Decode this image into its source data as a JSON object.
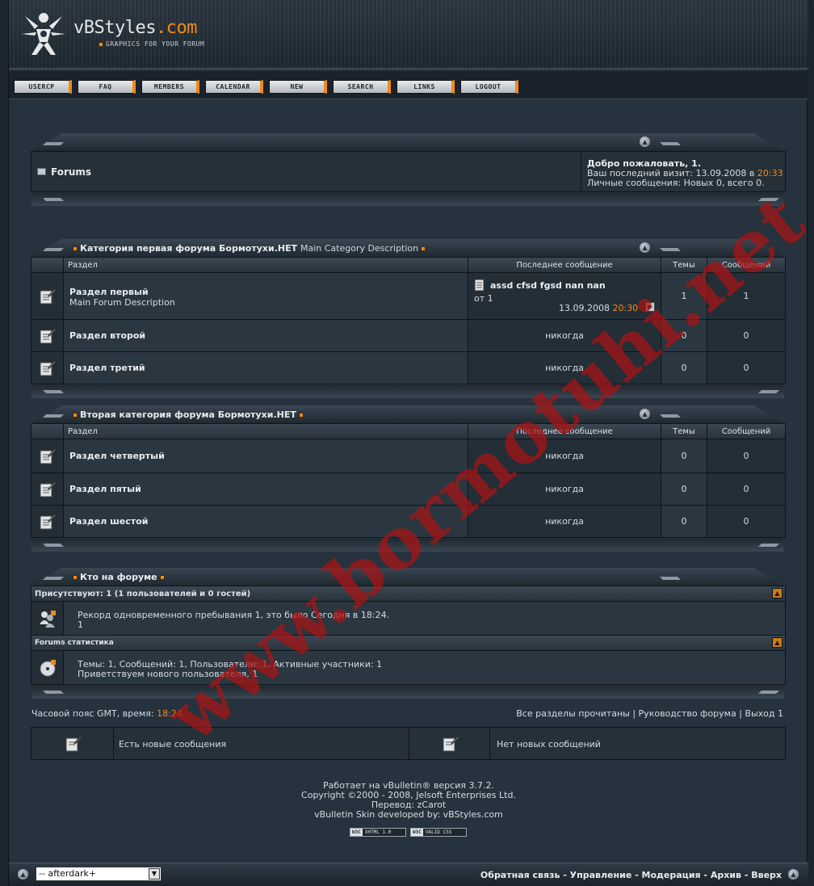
{
  "header": {
    "logo_main": "vBStyles",
    "logo_dot": ".com",
    "logo_sub": "GRAPHICS FOR YOUR FORUM"
  },
  "nav": [
    "USERCP",
    "FAQ",
    "MEMBERS",
    "CALENDAR",
    "NEW",
    "SEARCH",
    "LINKS",
    "LOGOUT"
  ],
  "welcome": {
    "breadcrumb": "Forums",
    "greeting": "Добро пожаловать, 1.",
    "last_visit_prefix": "Ваш последний визит: 13.09.2008 в ",
    "last_visit_time": "20:33",
    "pm": "Личные сообщения: Новых 0, всего 0."
  },
  "columns": {
    "section": "Раздел",
    "last_post": "Последнее сообщение",
    "threads": "Темы",
    "posts": "Сообщений"
  },
  "categories": [
    {
      "title": "Категория первая форума Бормотухи.НЕТ",
      "description": "Main Category Description",
      "forums": [
        {
          "name": "Раздел первый",
          "desc": "Main Forum Description",
          "last_title": "assd cfsd fgsd nan nan",
          "last_by": "от 1",
          "last_date": "13.09.2008",
          "last_time": "20:30",
          "threads": "1",
          "posts": "1"
        },
        {
          "name": "Раздел второй",
          "last": "никогда",
          "threads": "0",
          "posts": "0"
        },
        {
          "name": "Раздел третий",
          "last": "никогда",
          "threads": "0",
          "posts": "0"
        }
      ]
    },
    {
      "title": "Вторая категория форума Бормотухи.НЕТ",
      "forums": [
        {
          "name": "Раздел четвертый",
          "last": "никогда",
          "threads": "0",
          "posts": "0"
        },
        {
          "name": "Раздел пятый",
          "last": "никогда",
          "threads": "0",
          "posts": "0"
        },
        {
          "name": "Раздел шестой",
          "last": "никогда",
          "threads": "0",
          "posts": "0"
        }
      ]
    }
  ],
  "whos_online": {
    "title": "Кто на форуме",
    "present_header": "Присутствуют: 1 (1 пользователей и 0 гостей)",
    "record": "Рекорд одновременного пребывания 1, это было Сегодня в 18:24.",
    "users": "1",
    "stats_header": "Forums статистика",
    "stats": "Темы: 1, Сообщений: 1, Пользователи: 1, Активные участники: 1",
    "welcome_new": "Приветствуем нового пользователя, 1"
  },
  "footer_bar": {
    "timezone_prefix": "Часовой пояс GMT, время: ",
    "time": "18:24",
    "links": [
      "Все разделы прочитаны",
      "Руководство форума",
      "Выход 1"
    ]
  },
  "legend": {
    "new_posts": "Есть новые сообщения",
    "no_new_posts": "Нет новых сообщений"
  },
  "credits": [
    "Работает на vBulletin® версия 3.7.2.",
    "Copyright ©2000 - 2008, Jelsoft Enterprises Ltd.",
    "Перевод: zCarot",
    "vBulletin Skin developed by: vBStyles.com"
  ],
  "badges": [
    "XHTML 1.0",
    "VALID CSS"
  ],
  "badge_w3c": "W3C",
  "bottom": {
    "style_select": "-- afterdark+",
    "links": [
      "Обратная связь",
      "Управление",
      "Модерация",
      "Архив",
      "Вверх"
    ]
  },
  "watermark": "www.bormotuhi.net"
}
